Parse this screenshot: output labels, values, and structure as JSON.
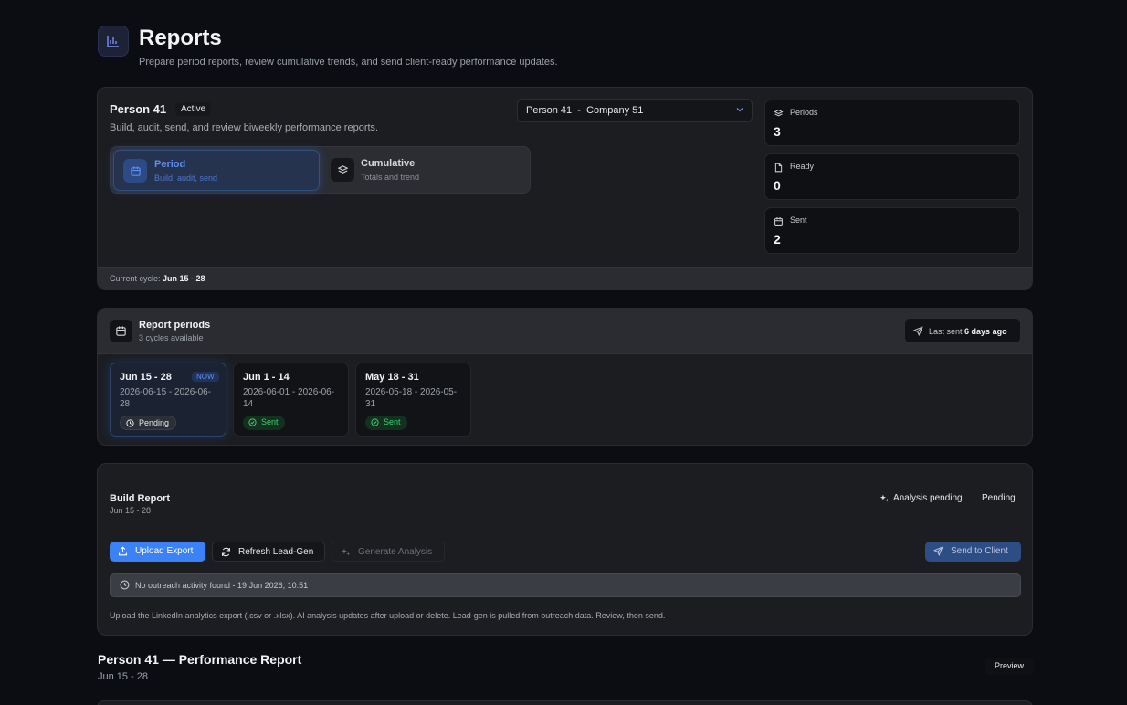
{
  "header": {
    "icon": "bar-chart-icon",
    "title": "Reports",
    "subtitle": "Prepare period reports, review cumulative trends, and send client-ready performance updates."
  },
  "overview": {
    "person": "Person 41",
    "status": "Active",
    "description": "Build, audit, send, and review biweekly performance reports.",
    "selected_account": "Person 41  -  Company 51",
    "modes": [
      {
        "title": "Period",
        "subtitle": "Build, audit, send",
        "icon": "calendar-icon",
        "active": true
      },
      {
        "title": "Cumulative",
        "subtitle": "Totals and trend",
        "icon": "layers-icon",
        "active": false
      }
    ],
    "stats": [
      {
        "label": "Periods",
        "value": "3",
        "icon": "layers-icon"
      },
      {
        "label": "Ready",
        "value": "0",
        "icon": "file-icon"
      },
      {
        "label": "Sent",
        "value": "2",
        "icon": "calendar-icon"
      }
    ],
    "cycle_label": "Current cycle:",
    "cycle_value": "Jun 15 - 28"
  },
  "periods": {
    "title": "Report periods",
    "subtitle": "3 cycles available",
    "last_sent_label": "Last sent",
    "last_sent_value": "6 days ago",
    "now_tag": "NOW",
    "items": [
      {
        "title": "Jun 15 - 28",
        "range": "2026-06-15 - 2026-06-28",
        "status": "Pending"
      },
      {
        "title": "Jun 1 - 14",
        "range": "2026-06-01 - 2026-06-14",
        "status": "Sent"
      },
      {
        "title": "May 18 - 31",
        "range": "2026-05-18 - 2026-05-31",
        "status": "Sent"
      }
    ]
  },
  "build": {
    "title": "Build Report",
    "subtitle": "Jun 15 - 28",
    "analysis_status": "Analysis pending",
    "status": "Pending",
    "buttons": {
      "upload": "Upload Export",
      "refresh": "Refresh Lead-Gen",
      "generate": "Generate Analysis",
      "send": "Send to Client"
    },
    "notice": "No outreach activity found - 19 Jun 2026, 10:51",
    "help": "Upload the LinkedIn analytics export (.csv or .xlsx). AI analysis updates after upload or delete. Lead-gen is pulled from outreach data. Review, then send."
  },
  "report": {
    "title": "Person 41 — Performance Report",
    "subtitle": "Jun 15 - 28",
    "preview": "Preview"
  },
  "colors": {
    "background": "#0b0d12",
    "accent": "#3b82f6",
    "success": "#3ecf73"
  }
}
